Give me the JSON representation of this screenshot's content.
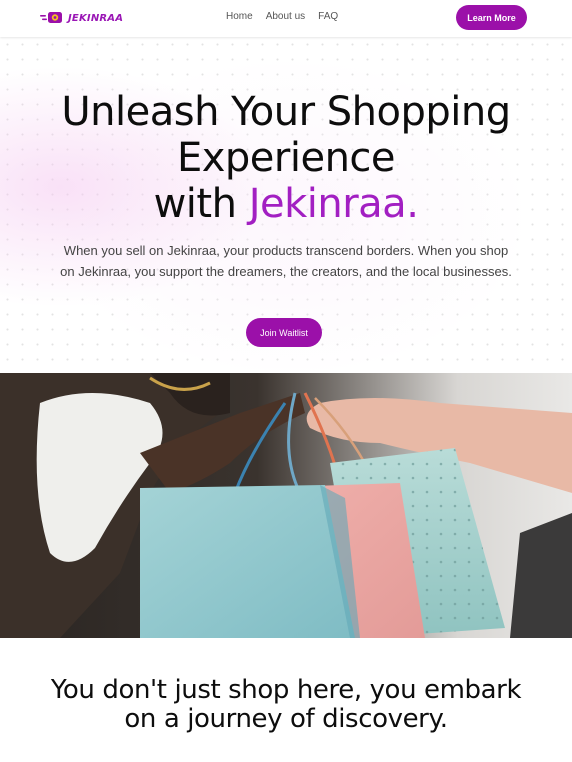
{
  "brand": {
    "name": "JEKINRAA",
    "color": "#9b10a9",
    "accent": "#a21fc2"
  },
  "nav": {
    "links": [
      "Home",
      "About us",
      "FAQ"
    ],
    "cta_label": "Learn More"
  },
  "hero": {
    "title_line1": "Unleash Your Shopping",
    "title_line2": "Experience",
    "title_with": "with",
    "title_brand": "Jekinraa.",
    "subtitle": "When you sell on Jekinraa, your products transcend borders. When you shop on Jekinraa, you support the dreamers, the creators, and the local businesses.",
    "cta_label": "Join Waitlist"
  },
  "photo": {
    "subject": "shopping-bags-handoff-photo"
  },
  "section": {
    "title_line1": "You don't just shop here, you embark",
    "title_line2": "on a journey of discovery."
  }
}
